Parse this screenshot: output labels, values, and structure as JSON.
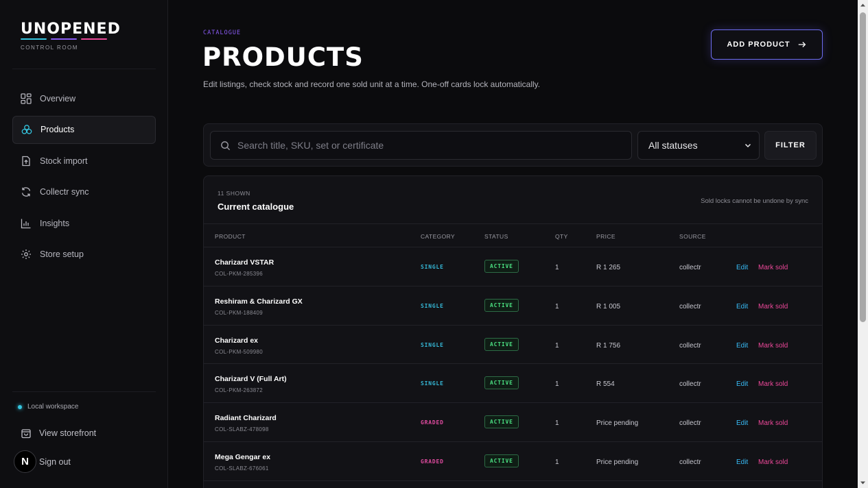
{
  "brand": {
    "name": "UNOPENED",
    "subtitle": "CONTROL ROOM",
    "accent_colors": [
      "#35c6e0",
      "#8b5cf6",
      "#ec4899"
    ]
  },
  "sidebar": {
    "items": [
      {
        "label": "Overview",
        "icon": "grid-icon",
        "active": false
      },
      {
        "label": "Products",
        "icon": "cards-icon",
        "active": true
      },
      {
        "label": "Stock import",
        "icon": "upload-icon",
        "active": false
      },
      {
        "label": "Collectr sync",
        "icon": "sync-icon",
        "active": false
      },
      {
        "label": "Insights",
        "icon": "bar-chart-icon",
        "active": false
      },
      {
        "label": "Store setup",
        "icon": "gear-icon",
        "active": false
      }
    ],
    "workspace": "Local workspace",
    "view_storefront": "View storefront",
    "sign_out": "Sign out",
    "avatar_letter": "N"
  },
  "header": {
    "eyebrow": "CATALOGUE",
    "title": "PRODUCTS",
    "description": "Edit listings, check stock and record one sold unit at a time. One-off cards lock automatically.",
    "add_button": "ADD PRODUCT"
  },
  "filters": {
    "search_placeholder": "Search title, SKU, set or certificate",
    "search_value": "",
    "status_selected": "All statuses",
    "filter_button": "FILTER"
  },
  "table": {
    "count": "11 SHOWN",
    "title": "Current catalogue",
    "note": "Sold locks cannot be undone by sync",
    "columns": [
      "PRODUCT",
      "CATEGORY",
      "STATUS",
      "QTY",
      "PRICE",
      "SOURCE"
    ],
    "rows": [
      {
        "name": "Charizard VSTAR",
        "sku": "COL-PKM-285396",
        "category": "SINGLE",
        "status": "ACTIVE",
        "qty": "1",
        "price": "R 1 265",
        "source": "collectr",
        "edit": "Edit",
        "mark": "Mark sold"
      },
      {
        "name": "Reshiram & Charizard GX",
        "sku": "COL-PKM-188409",
        "category": "SINGLE",
        "status": "ACTIVE",
        "qty": "1",
        "price": "R 1 005",
        "source": "collectr",
        "edit": "Edit",
        "mark": "Mark sold"
      },
      {
        "name": "Charizard ex",
        "sku": "COL-PKM-509980",
        "category": "SINGLE",
        "status": "ACTIVE",
        "qty": "1",
        "price": "R 1 756",
        "source": "collectr",
        "edit": "Edit",
        "mark": "Mark sold"
      },
      {
        "name": "Charizard V (Full Art)",
        "sku": "COL-PKM-263872",
        "category": "SINGLE",
        "status": "ACTIVE",
        "qty": "1",
        "price": "R 554",
        "source": "collectr",
        "edit": "Edit",
        "mark": "Mark sold"
      },
      {
        "name": "Radiant Charizard",
        "sku": "COL-SLABZ-478098",
        "category": "GRADED",
        "status": "ACTIVE",
        "qty": "1",
        "price": "Price pending",
        "source": "collectr",
        "edit": "Edit",
        "mark": "Mark sold"
      },
      {
        "name": "Mega Gengar ex",
        "sku": "COL-SLABZ-676061",
        "category": "GRADED",
        "status": "ACTIVE",
        "qty": "1",
        "price": "Price pending",
        "source": "collectr",
        "edit": "Edit",
        "mark": "Mark sold"
      }
    ]
  }
}
